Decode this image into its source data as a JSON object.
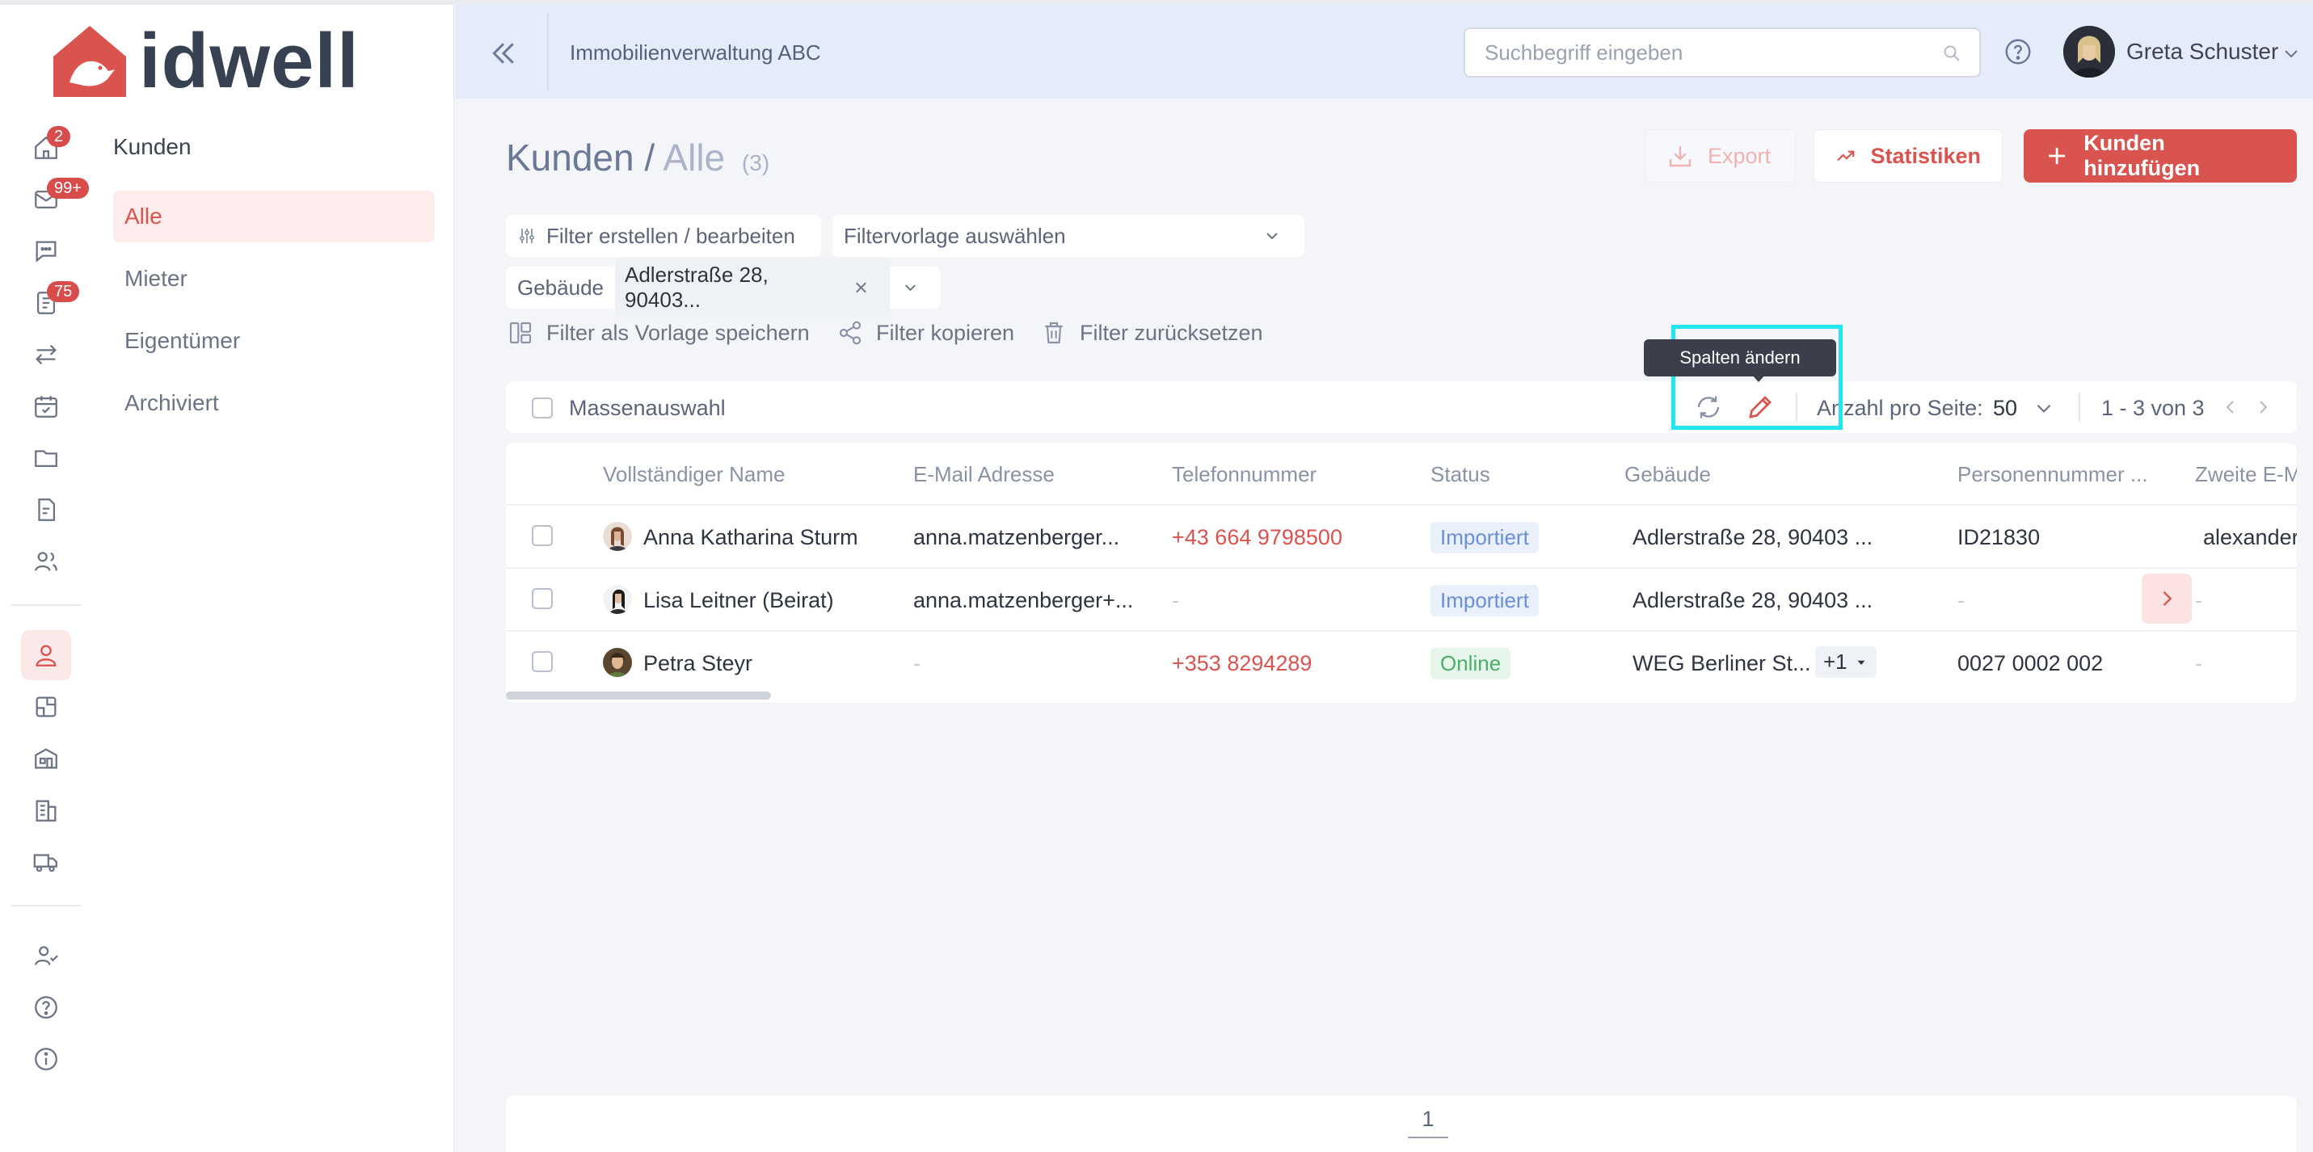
{
  "brand": {
    "name": "idwell",
    "accent": "#d9534f"
  },
  "rail": {
    "badges": {
      "home": "2",
      "mail": "99+",
      "tasks": "75"
    },
    "icons": [
      "home-icon",
      "mail-icon",
      "chat-icon",
      "tasks-icon",
      "transfer-icon",
      "calendar-icon",
      "folder-icon",
      "document-icon",
      "users-icon",
      "person-icon",
      "plan-icon",
      "building-icon",
      "buildings-icon",
      "truck-icon",
      "user-check-icon",
      "help-icon",
      "info-icon"
    ]
  },
  "subnav": {
    "title": "Kunden",
    "items": [
      {
        "label": "Alle",
        "active": true
      },
      {
        "label": "Mieter"
      },
      {
        "label": "Eigentümer"
      },
      {
        "label": "Archiviert"
      }
    ]
  },
  "header": {
    "title": "Immobilienverwaltung ABC",
    "search_placeholder": "Suchbegriff eingeben",
    "user_name": "Greta Schuster"
  },
  "page": {
    "title": "Kunden",
    "sep": "/",
    "crumb": "Alle",
    "count": "(3)",
    "export_label": "Export",
    "stats_label": "Statistiken",
    "add_label": "Kunden hinzufügen"
  },
  "filters": {
    "edit_label": "Filter erstellen / bearbeiten",
    "template_placeholder": "Filtervorlage auswählen",
    "building_label": "Gebäude",
    "building_value": "Adlerstraße 28, 90403...",
    "save_template": "Filter als Vorlage speichern",
    "copy_filter": "Filter kopieren",
    "reset_filter": "Filter zurücksetzen"
  },
  "toolbar": {
    "mass_select": "Massenauswahl",
    "tooltip": "Spalten ändern",
    "per_page_label": "Anzahl pro Seite:",
    "per_page_value": "50",
    "range": "1 - 3 von 3"
  },
  "table": {
    "columns": [
      "Vollständiger Name",
      "E-Mail Adresse",
      "Telefonnummer",
      "Status",
      "Gebäude",
      "Personennummer ...",
      "Zweite E-M"
    ],
    "rows": [
      {
        "name": "Anna Katharina Sturm",
        "email": "anna.matzenberger...",
        "phone": "+43 664 9798500",
        "status": "Importiert",
        "building": "Adlerstraße 28, 90403 ...",
        "personnr": "ID21830",
        "email2": "alexander"
      },
      {
        "name": "Lisa Leitner (Beirat)",
        "email": "anna.matzenberger+...",
        "phone": "-",
        "status": "Importiert",
        "building": "Adlerstraße 28, 90403 ...",
        "personnr": "-",
        "email2": "-"
      },
      {
        "name": "Petra Steyr",
        "email": "-",
        "phone": "+353 8294289",
        "status": "Online",
        "building": "WEG Berliner St...",
        "building_more": "+1",
        "personnr": "0027 0002 002",
        "email2": "-"
      }
    ]
  },
  "pagination": {
    "page": "1"
  }
}
